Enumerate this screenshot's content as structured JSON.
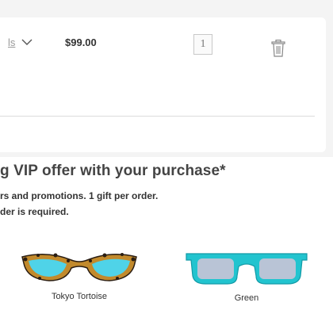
{
  "cart": {
    "details_link_text": "ls",
    "price": "$99.00",
    "quantity": "1"
  },
  "offer": {
    "title": "g VIP offer with your purchase*",
    "line1": "rs and promotions. 1 gift per order.",
    "line2": "der is required."
  },
  "products": [
    {
      "name": "Tokyo Tortoise"
    },
    {
      "name": "Green"
    }
  ],
  "colors": {
    "tortoise_frame": "#c28a2c",
    "tortoise_spots": "#2a1d12",
    "lens_blue": "#4fd3e8",
    "green_frame": "#22c4cf",
    "lens_gray": "#b9c4d6"
  }
}
